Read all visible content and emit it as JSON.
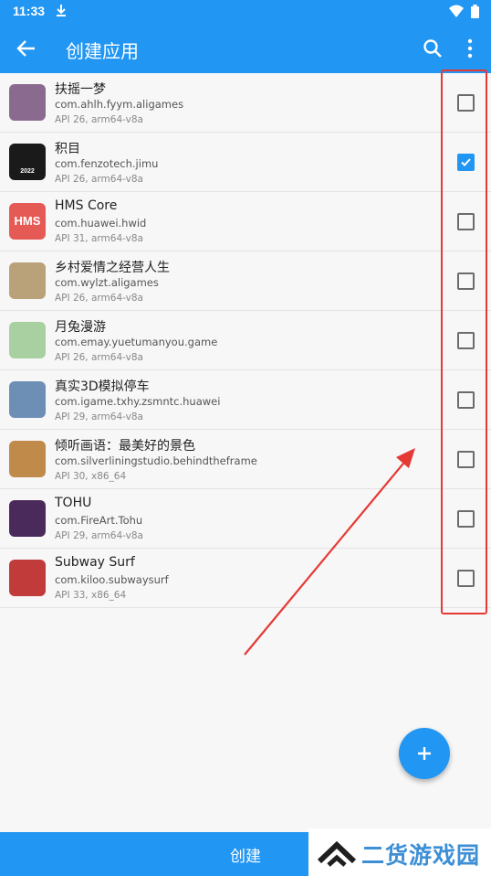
{
  "status": {
    "time": "11:33"
  },
  "header": {
    "title": "创建应用"
  },
  "apps": [
    {
      "name": "扶摇一梦",
      "package": "com.ahlh.fyym.aligames",
      "meta": "API 26, arm64-v8a",
      "checked": false,
      "icon_color": "#8a6b8f"
    },
    {
      "name": "积目",
      "package": "com.fenzotech.jimu",
      "meta": "API 26, arm64-v8a",
      "checked": true,
      "icon_color": "#1a1a1a",
      "icon_text": "2022"
    },
    {
      "name": "HMS Core",
      "package": "com.huawei.hwid",
      "meta": "API 31, arm64-v8a",
      "checked": false,
      "icon_color": "#e65a55",
      "icon_text": "HMS"
    },
    {
      "name": "乡村爱情之经营人生",
      "package": "com.wylzt.aligames",
      "meta": "API 26, arm64-v8a",
      "checked": false,
      "icon_color": "#b9a27a"
    },
    {
      "name": "月兔漫游",
      "package": "com.emay.yuetumanyou.game",
      "meta": "API 26, arm64-v8a",
      "checked": false,
      "icon_color": "#a8d0a0"
    },
    {
      "name": "真实3D模拟停车",
      "package": "com.igame.txhy.zsmntc.huawei",
      "meta": "API 29, arm64-v8a",
      "checked": false,
      "icon_color": "#6e8fb5"
    },
    {
      "name": "倾听画语：最美好的景色",
      "package": "com.silverliningstudio.behindtheframe",
      "meta": "API 30, x86_64",
      "checked": false,
      "icon_color": "#c08a4a"
    },
    {
      "name": "TOHU",
      "package": "com.FireArt.Tohu",
      "meta": "API 29, arm64-v8a",
      "checked": false,
      "icon_color": "#4a2a5a"
    },
    {
      "name": "Subway Surf",
      "package": "com.kiloo.subwaysurf",
      "meta": "API 33, x86_64",
      "checked": false,
      "icon_color": "#c23b3b"
    }
  ],
  "bottom": {
    "create_label": "创建"
  },
  "watermark": {
    "text": "二货游戏园"
  },
  "colors": {
    "primary": "#2196f3",
    "annotation": "#e53935"
  }
}
